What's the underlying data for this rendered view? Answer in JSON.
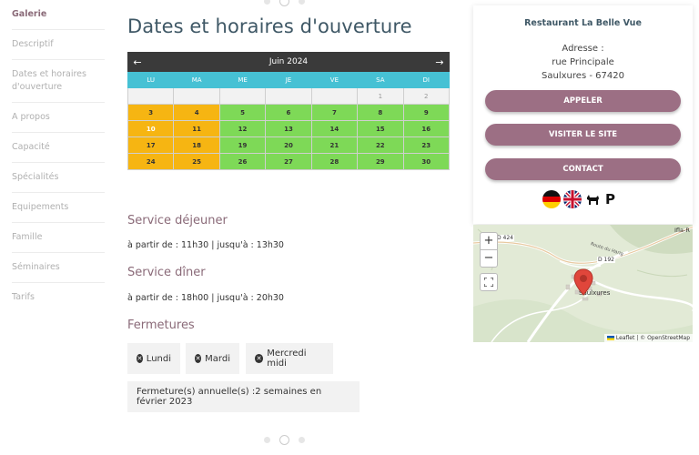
{
  "sidebar": {
    "items": [
      {
        "label": "Galerie"
      },
      {
        "label": "Descriptif"
      },
      {
        "label": "Dates et horaires d'ouverture"
      },
      {
        "label": "A propos"
      },
      {
        "label": "Capacité"
      },
      {
        "label": "Spécialités"
      },
      {
        "label": "Equipements"
      },
      {
        "label": "Famille"
      },
      {
        "label": "Séminaires"
      },
      {
        "label": "Tarifs"
      }
    ]
  },
  "main": {
    "title": "Dates et horaires d'ouverture",
    "calendar": {
      "month": "Juin 2024",
      "prev": "←",
      "next": "→",
      "weekdays": [
        "LU",
        "MA",
        "ME",
        "JE",
        "VE",
        "SA",
        "DI"
      ],
      "weeks": [
        [
          "",
          "",
          "",
          "",
          "",
          "1",
          "2"
        ],
        [
          "3",
          "4",
          "5",
          "6",
          "7",
          "8",
          "9"
        ],
        [
          "10",
          "11",
          "12",
          "13",
          "14",
          "15",
          "16"
        ],
        [
          "17",
          "18",
          "19",
          "20",
          "21",
          "22",
          "23"
        ],
        [
          "24",
          "25",
          "26",
          "27",
          "28",
          "29",
          "30"
        ]
      ]
    },
    "lunch": {
      "title": "Service déjeuner",
      "hours": "à partir de : 11h30 | jusqu'à : 13h30"
    },
    "dinner": {
      "title": "Service dîner",
      "hours": "à partir de : 18h00 | jusqu'à : 20h30"
    },
    "closures": {
      "title": "Fermetures",
      "days": [
        "Lundi",
        "Mardi",
        "Mercredi midi"
      ],
      "annual": "Fermeture(s) annuelle(s) :2 semaines en février 2023"
    }
  },
  "card": {
    "name": "Restaurant La Belle Vue",
    "address_label": "Adresse :",
    "street": "rue Principale",
    "city": "Saulxures - 67420",
    "buttons": {
      "call": "APPELER",
      "site": "VISITER LE SITE",
      "contact": "CONTACT"
    },
    "parking": "P"
  },
  "map": {
    "zoom_in": "+",
    "zoom_out": "−",
    "road_1": "D 424",
    "road_2": "D 192",
    "road_3": "Route du Harig",
    "town": "Saulxures",
    "town_2": "Ifla-R",
    "attribution": "Leaflet | © OpenStreetMap"
  },
  "colors": {
    "accent": "#9c6f84",
    "open": "#7ed957",
    "closed": "#f6b512",
    "header": "#46c1d4"
  }
}
